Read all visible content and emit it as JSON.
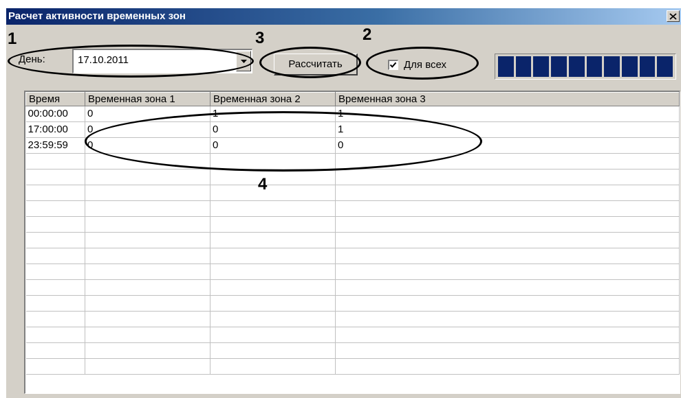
{
  "window": {
    "title": "Расчет активности временных зон",
    "close_symbol": "✕"
  },
  "toolbar": {
    "day_label": "День:",
    "day_value": "17.10.2011",
    "calc_button": "Рассчитать",
    "for_all_label": "Для всех",
    "for_all_checked": true,
    "progress_segments": 10,
    "progress_fraction": 1.0
  },
  "annotations": {
    "n1": "1",
    "n2": "2",
    "n3": "3",
    "n4": "4"
  },
  "table": {
    "columns": [
      "Время",
      "Временная зона 1",
      "Временная зона 2",
      "Временная зона 3"
    ],
    "rows": [
      [
        "00:00:00",
        "0",
        "1",
        "1"
      ],
      [
        "17:00:00",
        "0",
        "0",
        "1"
      ],
      [
        "23:59:59",
        "0",
        "0",
        "0"
      ]
    ],
    "empty_rows": 14
  },
  "colors": {
    "titlebar": "#0a246a",
    "progress": "#0a246a",
    "face": "#d4d0c8"
  }
}
